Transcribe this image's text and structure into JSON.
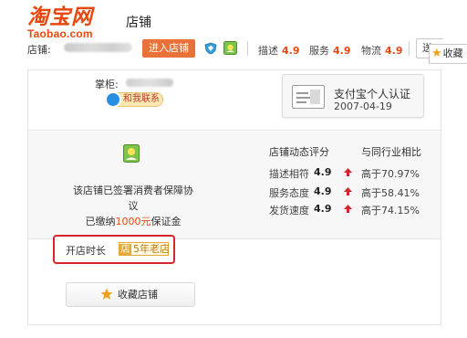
{
  "header": {
    "logo_cn": "淘宝网",
    "logo_en": "Taobao.com",
    "shop_label": "店铺"
  },
  "bar": {
    "shop_prefix": "店铺:",
    "enter_button": "进入店铺",
    "ratings": [
      {
        "label": "描述",
        "value": "4.9"
      },
      {
        "label": "服务",
        "value": "4.9"
      },
      {
        "label": "物流",
        "value": "4.9"
      }
    ],
    "send_button": "送",
    "favorite_tab": "收藏"
  },
  "card": {
    "keeper_label": "掌柜:",
    "contact_button": "和我联系",
    "cert": {
      "title": "支付宝个人认证",
      "date": "2007-04-19"
    },
    "agreement": {
      "line1": "该店铺已签署消费者保障协议",
      "line2_prefix": "已缴纳",
      "line2_money": "1000元",
      "line2_suffix": "保证金"
    },
    "dynamic_rating": {
      "head_left": "店铺动态评分",
      "head_right": "与同行业相比",
      "rows": [
        {
          "label": "描述相符",
          "value": "4.9",
          "compare": "高于70.97%"
        },
        {
          "label": "服务态度",
          "value": "4.9",
          "compare": "高于58.41%"
        },
        {
          "label": "发货速度",
          "value": "4.9",
          "compare": "高于74.15%"
        }
      ]
    },
    "open_time": {
      "label": "开店时长",
      "badge_char": "店",
      "badge_text": "5年老店"
    },
    "favorite_shop_button": "收藏店铺"
  },
  "colors": {
    "brand": "#e8480e",
    "enter_button_bg": "#e8723a",
    "highlight_border": "#d6252b",
    "up_arrow": "#d6252b"
  },
  "icons": [
    "shield-badge-icon",
    "flower-badge-icon",
    "wangwang-icon",
    "id-card-icon",
    "consumer-protection-shield-icon",
    "up-arrow-icon",
    "star-icon"
  ]
}
